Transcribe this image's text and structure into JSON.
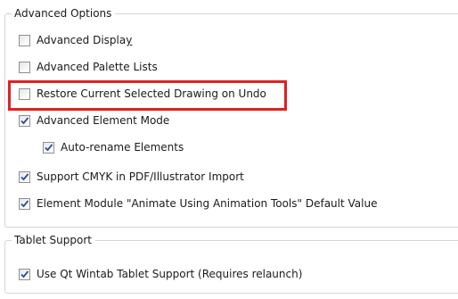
{
  "advanced_options": {
    "title": "Advanced Options",
    "items": [
      {
        "label": "Advanced Displa",
        "label_underlined": "y",
        "checked": false
      },
      {
        "label": "Advanced Palette Lists",
        "checked": false
      },
      {
        "label": "Restore Current Selected Drawing on Undo",
        "checked": false,
        "highlighted": true
      },
      {
        "label": "Advanced Element Mode",
        "checked": true
      },
      {
        "label": "Auto-rename Elements",
        "checked": true
      },
      {
        "label": "Support CMYK in PDF/Illustrator Import",
        "checked": true
      },
      {
        "label": "Element Module \"Animate Using Animation Tools\" Default Value",
        "checked": true
      }
    ]
  },
  "tablet_support": {
    "title": "Tablet Support",
    "items": [
      {
        "label": "Use Qt Wintab Tablet Support (Requires relaunch)",
        "checked": true
      }
    ]
  },
  "colors": {
    "highlight": "#e02020",
    "checkmark": "#2a4f8f"
  }
}
